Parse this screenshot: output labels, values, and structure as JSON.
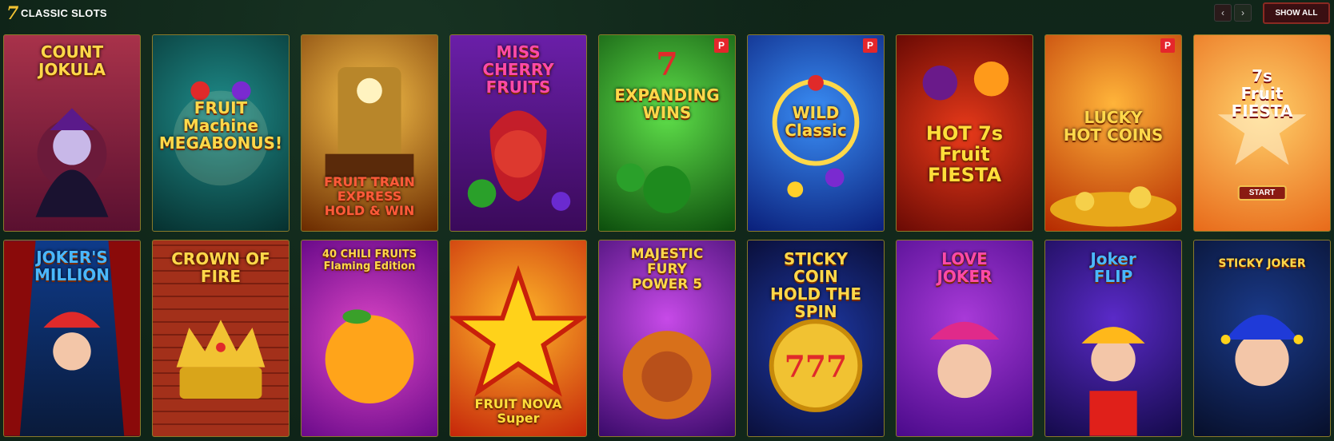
{
  "header": {
    "icon": "seven-icon",
    "icon_glyph": "7",
    "title": "CLASSIC SLOTS",
    "prev_glyph": "‹",
    "next_glyph": "›",
    "show_all_label": "SHOW ALL"
  },
  "games": [
    {
      "title": "COUNT\nJOKULA",
      "badge": ""
    },
    {
      "title": "FRUIT\nMachine\nMEGABONUS!",
      "badge": ""
    },
    {
      "title": "FRUIT TRAIN\nEXPRESS\nHOLD & WIN",
      "badge": ""
    },
    {
      "title": "MISS\nCHERRY\nFRUITS",
      "badge": ""
    },
    {
      "title": "EXPANDING\nWINS",
      "badge": "P"
    },
    {
      "title": "WILD\nClassic",
      "badge": "P"
    },
    {
      "title": "HOT 7s\nFruit\nFIESTA",
      "badge": ""
    },
    {
      "title": "LUCKY\nHOT COINS",
      "badge": "P"
    },
    {
      "title": "7s\nFruit\nFIESTA",
      "badge": "",
      "button": "START"
    },
    {
      "title": "JOKER'S\nMILLION",
      "badge": ""
    },
    {
      "title": "CROWN OF\nFIRE",
      "badge": ""
    },
    {
      "title": "40 CHILI FRUITS\nFlaming Edition",
      "badge": ""
    },
    {
      "title": "FRUIT NOVA\nSuper",
      "badge": ""
    },
    {
      "title": "MAJESTIC\nFURY\nPOWER 5",
      "badge": ""
    },
    {
      "title": "STICKY\nCOIN\nHOLD THE SPIN",
      "badge": ""
    },
    {
      "title": "LOVE\nJOKER",
      "badge": ""
    },
    {
      "title": "Joker\nFLIP",
      "badge": ""
    },
    {
      "title": "STICKY JOKER",
      "badge": ""
    }
  ],
  "colors": {
    "accent_gold": "#f1c232",
    "show_all_border": "#8a2a22",
    "tile_border": "#8a7a2a",
    "badge_red": "#e5262b"
  }
}
